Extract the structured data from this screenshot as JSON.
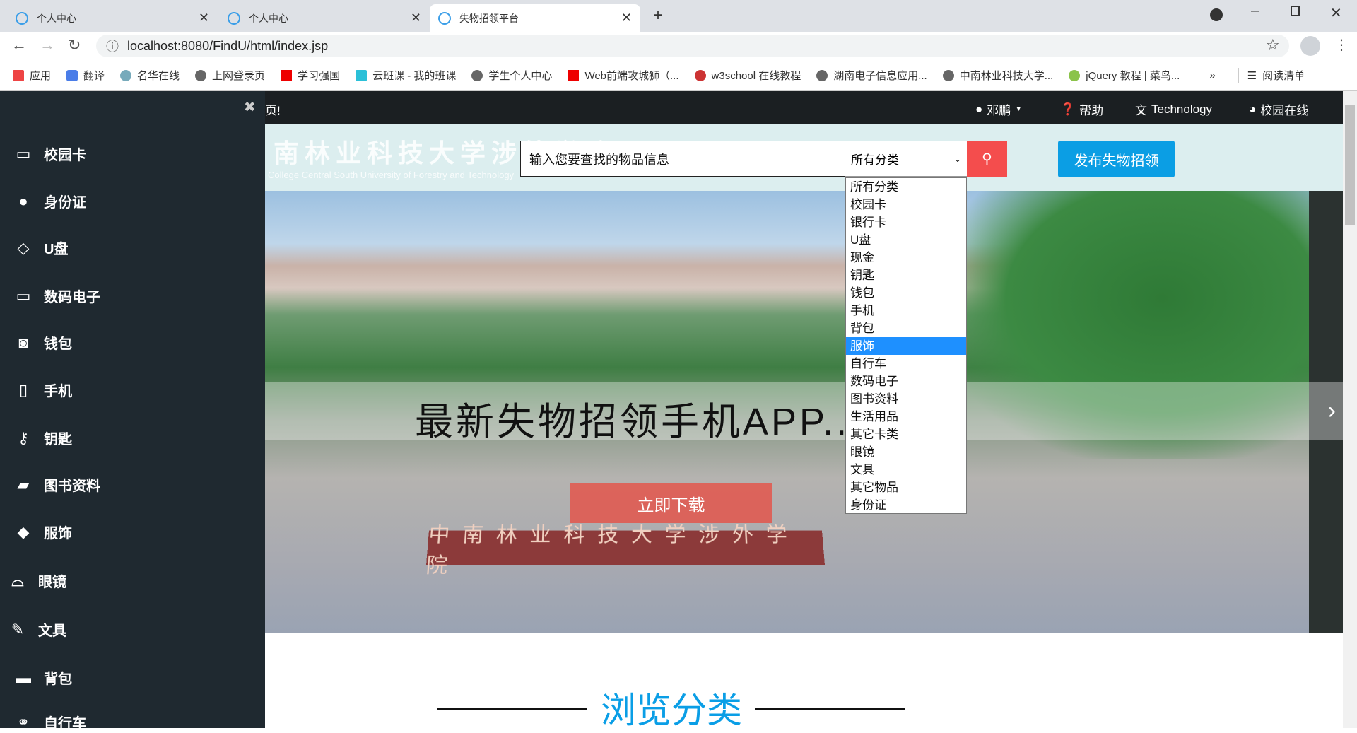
{
  "browser": {
    "tabs": [
      {
        "title": "个人中心",
        "active": false
      },
      {
        "title": "个人中心",
        "active": false
      },
      {
        "title": "失物招领平台",
        "active": true
      }
    ],
    "url": "localhost:8080/FindU/html/index.jsp",
    "bookmarks": [
      "应用",
      "翻译",
      "名华在线",
      "上网登录页",
      "学习强国",
      "云班课 - 我的班课",
      "学生个人中心",
      "Web前端攻城狮（...",
      "w3school 在线教程",
      "湖南电子信息应用...",
      "中南林业科技大学...",
      "jQuery 教程 | 菜鸟..."
    ],
    "more": "»",
    "reading_list": "阅读清单"
  },
  "sidebar": {
    "items": [
      "校园卡",
      "身份证",
      "U盘",
      "数码电子",
      "钱包",
      "手机",
      "钥匙",
      "图书资料",
      "服饰",
      "眼镜",
      "文具",
      "背包",
      "自行车"
    ]
  },
  "topnav": {
    "welcome_fragment": "页!",
    "user": "邓鹏",
    "help": "帮助",
    "tech": "Technology",
    "campus": "校园在线"
  },
  "header": {
    "logo_text": "南林业科技大学涉外学院",
    "logo_sub": "College Central South University of Forestry and Technology",
    "search_placeholder": "输入您要查找的物品信息",
    "category_selected": "所有分类",
    "publish": "发布失物招领"
  },
  "dropdown": {
    "options": [
      "所有分类",
      "校园卡",
      "银行卡",
      "U盘",
      "现金",
      "钥匙",
      "钱包",
      "手机",
      "背包",
      "服饰",
      "自行车",
      "数码电子",
      "图书资料",
      "生活用品",
      "其它卡类",
      "眼镜",
      "文具",
      "其它物品",
      "身份证"
    ],
    "highlighted": "服饰"
  },
  "banner": {
    "caption": "最新失物招领手机APP...",
    "download": "立即下载",
    "gate_text": "中南林业科技大学涉外学院"
  },
  "section": {
    "title": "浏览分类"
  },
  "colors": {
    "sidebar": "#1f2930",
    "accent_blue": "#0b9ee4",
    "search_red": "#f44d4d"
  }
}
